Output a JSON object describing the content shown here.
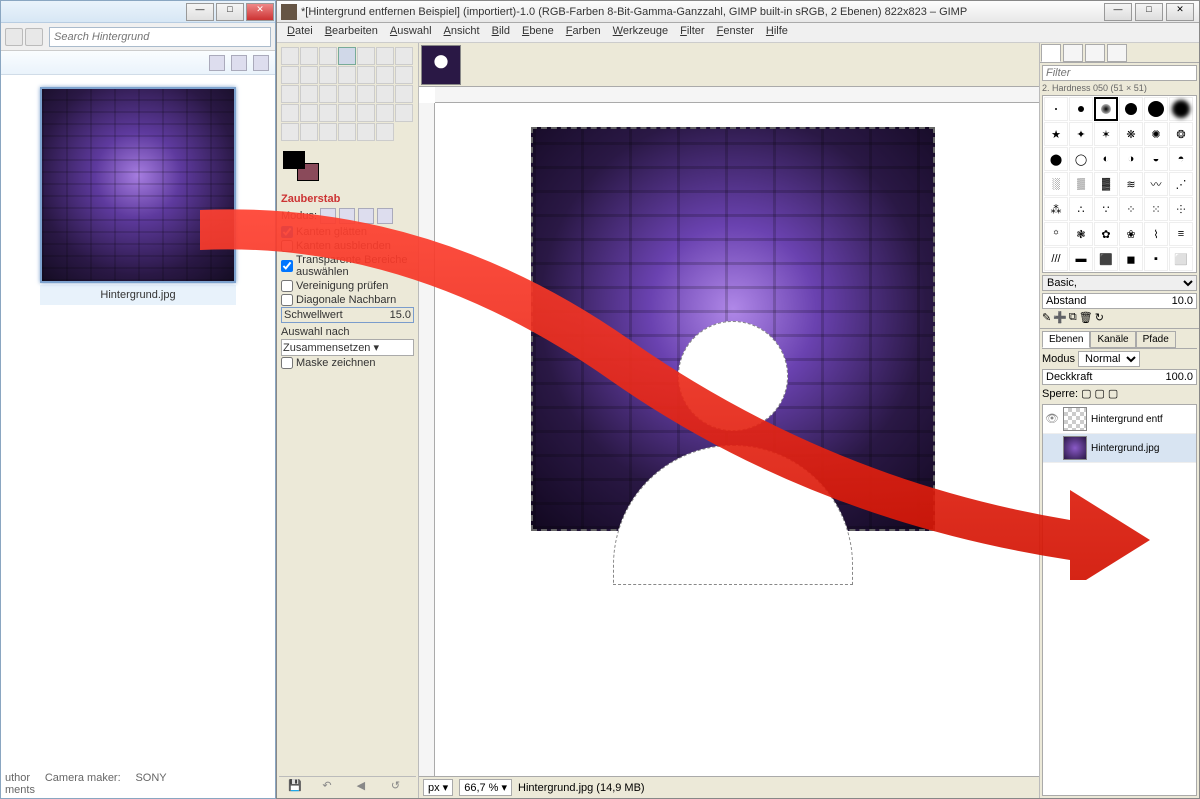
{
  "explorer": {
    "search_placeholder": "Search Hintergrund",
    "thumbnail_label": "Hintergrund.jpg",
    "meta_author": "uthor",
    "meta_camera_label": "Camera maker:",
    "meta_camera_value": "SONY",
    "meta_comments": "ments"
  },
  "gimp": {
    "title": "*[Hintergrund entfernen Beispiel] (importiert)-1.0 (RGB-Farben 8-Bit-Gamma-Ganzzahl, GIMP built-in sRGB, 2 Ebenen) 822x823 – GIMP",
    "menu": [
      "Datei",
      "Bearbeiten",
      "Auswahl",
      "Ansicht",
      "Bild",
      "Ebene",
      "Farben",
      "Werkzeuge",
      "Filter",
      "Fenster",
      "Hilfe"
    ]
  },
  "tool_options": {
    "header": "Zauberstab",
    "mode_label": "Modus:",
    "antialias": "Kanten glätten",
    "feather": "Kanten ausblenden",
    "transparent": "Transparente Bereiche auswählen",
    "sample_merged": "Vereinigung prüfen",
    "diagonal": "Diagonale Nachbarn",
    "threshold_label": "Schwellwert",
    "threshold_value": "15.0",
    "select_by_label": "Auswahl nach",
    "select_by_value": "Zusammensetzen",
    "draw_mask": "Maske zeichnen"
  },
  "canvas_footer": {
    "unit": "px",
    "zoom": "66,7 %",
    "status": "Hintergrund.jpg (14,9 MB)"
  },
  "brushes": {
    "filter_placeholder": "Filter",
    "current": "2. Hardness 050 (51 × 51)",
    "preset_label": "Basic,",
    "spacing_label": "Abstand",
    "spacing_value": "10.0"
  },
  "layers": {
    "tabs": [
      "Ebenen",
      "Kanäle",
      "Pfade"
    ],
    "mode_label": "Modus",
    "mode_value": "Normal",
    "opacity_label": "Deckkraft",
    "opacity_value": "100.0",
    "lock_label": "Sperre:",
    "items": [
      {
        "name": "Hintergrund entf"
      },
      {
        "name": "Hintergrund.jpg"
      }
    ]
  }
}
